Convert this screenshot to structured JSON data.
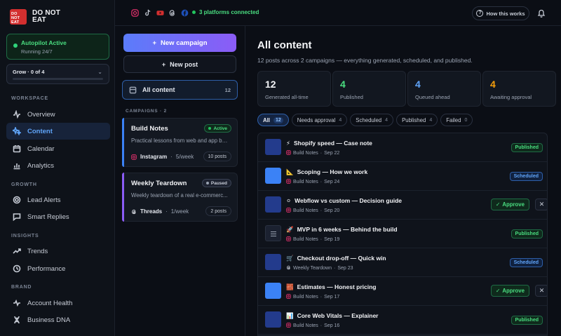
{
  "brand": {
    "logo_text": "DO NOT EAT",
    "name_line1": "DO NOT",
    "name_line2": "EAT"
  },
  "autopilot": {
    "title": "Autopilot Active",
    "status": "Running 24/7"
  },
  "grow": {
    "label": "Grow · 0 of 4",
    "progress_fraction": 0
  },
  "sidebar": {
    "sections": [
      "WORKSPACE",
      "GROWTH",
      "INSIGHTS",
      "BRAND"
    ],
    "items": [
      {
        "label": "Overview",
        "icon": "activity-icon"
      },
      {
        "label": "Content",
        "icon": "sparkles-icon",
        "active": true
      },
      {
        "label": "Calendar",
        "icon": "calendar-icon"
      },
      {
        "label": "Analytics",
        "icon": "bar-chart-icon"
      },
      {
        "label": "Lead Alerts",
        "icon": "target-icon"
      },
      {
        "label": "Smart Replies",
        "icon": "message-icon"
      },
      {
        "label": "Trends",
        "icon": "trending-up-icon"
      },
      {
        "label": "Performance",
        "icon": "gauge-icon"
      },
      {
        "label": "Account Health",
        "icon": "heartbeat-icon"
      },
      {
        "label": "Business DNA",
        "icon": "dna-icon"
      }
    ]
  },
  "topbar": {
    "platforms": [
      "instagram-icon",
      "tiktok-icon",
      "youtube-icon",
      "threads-icon",
      "facebook-icon"
    ],
    "connected": "3 platforms connected",
    "how_label": "How this works"
  },
  "campaigns_col": {
    "new_campaign": "New campaign",
    "new_post": "New post",
    "all_content": "All content",
    "all_count": "12",
    "header": "CAMPAIGNS · 2",
    "items": [
      {
        "name": "Build Notes",
        "badge": "Active",
        "desc": "Practical lessons from web and app bui...",
        "platform": "Instagram",
        "freq": "5/week",
        "posts": "10 posts"
      },
      {
        "name": "Weekly Teardown",
        "badge": "Paused",
        "desc": "Weekly teardown of a real e-commerc...",
        "platform": "Threads",
        "freq": "1/week",
        "posts": "2 posts"
      }
    ]
  },
  "main": {
    "title": "All content",
    "subtitle": "12 posts across 2 campaigns — everything generated, scheduled, and published.",
    "stats": [
      {
        "value": "12",
        "label": "Generated all-time",
        "color": "#f3f4f7"
      },
      {
        "value": "4",
        "label": "Published",
        "color": "#4ade80"
      },
      {
        "value": "4",
        "label": "Queued ahead",
        "color": "#60a5fa"
      },
      {
        "value": "4",
        "label": "Awaiting approval",
        "color": "#f59e0b"
      }
    ],
    "filters": [
      {
        "label": "All",
        "count": "12"
      },
      {
        "label": "Needs approval",
        "count": "4"
      },
      {
        "label": "Scheduled",
        "count": "4"
      },
      {
        "label": "Published",
        "count": "4"
      },
      {
        "label": "Failed",
        "count": "0"
      }
    ],
    "approve_label": "Approve",
    "posts": [
      {
        "emoji": "⚡",
        "title": "Shopify speed — Case note",
        "campaign": "Build Notes",
        "date": "Sep 22",
        "status": "Published",
        "thumb": "dark"
      },
      {
        "emoji": "📐",
        "title": "Scoping — How we work",
        "campaign": "Build Notes",
        "date": "Sep 24",
        "status": "Scheduled",
        "thumb": "light"
      },
      {
        "emoji": "⚪",
        "title": "Webflow vs custom — Decision guide",
        "campaign": "Build Notes",
        "date": "Sep 20",
        "status": "Approval",
        "thumb": "dark"
      },
      {
        "emoji": "🚀",
        "title": "MVP in 6 weeks — Behind the build",
        "campaign": "Build Notes",
        "date": "Sep 19",
        "status": "Published",
        "thumb": "menu"
      },
      {
        "emoji": "🛒",
        "title": "Checkout drop-off — Quick win",
        "campaign": "Weekly Teardown",
        "date": "Sep 23",
        "status": "Scheduled",
        "thumb": "dark"
      },
      {
        "emoji": "🧱",
        "title": "Estimates — Honest pricing",
        "campaign": "Build Notes",
        "date": "Sep 17",
        "status": "Approval",
        "thumb": "light"
      },
      {
        "emoji": "📊",
        "title": "Core Web Vitals — Explainer",
        "campaign": "Build Notes",
        "date": "Sep 16",
        "status": "Published",
        "thumb": "dark"
      }
    ]
  }
}
